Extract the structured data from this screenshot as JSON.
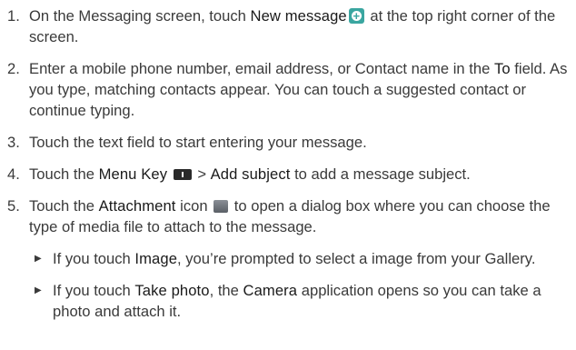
{
  "steps": [
    {
      "num": "1.",
      "t1": "On the Messaging screen, touch ",
      "b1": "New message",
      "icon": "new-message-icon",
      "t2": " at the top right corner of the screen."
    },
    {
      "num": "2.",
      "t1": "Enter a mobile phone number, email address, or Contact name in the ",
      "b1": "To",
      "t2": " field. As you type, matching contacts appear. You can touch a suggested contact or continue typing."
    },
    {
      "num": "3.",
      "t1": "Touch the text field to start entering your message."
    },
    {
      "num": "4.",
      "t1": "Touch the ",
      "b1": "Menu Key",
      "icon": "menu-key-icon",
      "t2": " > ",
      "b2": "Add subject",
      "t3": " to add a message subject."
    },
    {
      "num": "5.",
      "t1": "Touch the ",
      "b1": "Attachment",
      "t2": " icon ",
      "icon": "attachment-icon",
      "t3": " to open a dialog box where you can choose the type of media file to attach to the message."
    }
  ],
  "bullets": [
    {
      "t1": "If you touch ",
      "b1": "Image",
      "t2": ", you’re prompted to select a image from your Gallery."
    },
    {
      "t1": "If you touch ",
      "b1": "Take photo",
      "t2": ", the ",
      "b2": "Camera",
      "t3": " application opens so you can take a photo and attach it."
    }
  ],
  "bullet_glyph": "▶"
}
